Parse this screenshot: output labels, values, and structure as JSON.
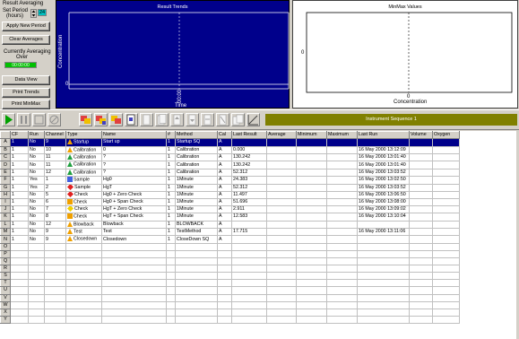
{
  "left_panel": {
    "heading": "Result Averaging",
    "set_period_label": "Set Period",
    "set_period_unit": "(hours)",
    "set_period_value": "24",
    "apply_button": "Apply New Period",
    "clear_button": "Clear Averages",
    "currently_label_1": "Currently Averaging",
    "currently_label_2": "Over",
    "currently_value": "00:00:00",
    "data_view_button": "Data View",
    "print_trends_button": "Print Trends",
    "print_minmax_button": "Print MinMax"
  },
  "trend_chart": {
    "title": "Result Trends",
    "ylabel": "Concentration",
    "xlabel": "Time",
    "y_tick": "0",
    "x_tick": "00:00"
  },
  "minmax_chart": {
    "title": "MinMax Values",
    "ylabel": "0",
    "xlabel": "Concentration",
    "x_tick": "0"
  },
  "toolbar": {
    "sequence_label": "Instrument Sequence 1"
  },
  "grid": {
    "columns": [
      "",
      "CF",
      "Run",
      "Channel",
      "Type",
      "Name",
      "#",
      "Method",
      "Cal",
      "Last Result",
      "Average",
      "Minimum",
      "Maximum",
      "Last Run",
      "Volume",
      "Oxygen"
    ],
    "rows": [
      {
        "h": "A",
        "cf": "1",
        "run": "No",
        "ch": "9",
        "icon": "tri-o",
        "type": "Startup",
        "name": "Start up",
        "num": "1",
        "method": "Startup SQ",
        "cal": "A",
        "last": "",
        "avg": "",
        "min": "",
        "max": "",
        "lastrun": "",
        "vol": "",
        "oxy": "",
        "selected": true
      },
      {
        "h": "B",
        "cf": "1",
        "run": "No",
        "ch": "10",
        "icon": "tri-o",
        "type": "Calibration",
        "name": "0",
        "num": "1",
        "method": "Calibration",
        "cal": "A",
        "last": "0.000",
        "avg": "",
        "min": "",
        "max": "",
        "lastrun": "16 May 2000   13:12:09",
        "vol": "",
        "oxy": ""
      },
      {
        "h": "C",
        "cf": "1",
        "run": "No",
        "ch": "11",
        "icon": "tri-g",
        "type": "Calibration",
        "name": "?",
        "num": "1",
        "method": "Calibration",
        "cal": "A",
        "last": "130.242",
        "avg": "",
        "min": "",
        "max": "",
        "lastrun": "16 May 2000   13:01:40",
        "vol": "",
        "oxy": ""
      },
      {
        "h": "D",
        "cf": "1",
        "run": "No",
        "ch": "11",
        "icon": "tri-g",
        "type": "Calibration",
        "name": "?",
        "num": "1",
        "method": "Calibration",
        "cal": "A",
        "last": "130.242",
        "avg": "",
        "min": "",
        "max": "",
        "lastrun": "16 May 2000   13:01:40",
        "vol": "",
        "oxy": ""
      },
      {
        "h": "E",
        "cf": "1",
        "run": "No",
        "ch": "12",
        "icon": "tri-g",
        "type": "Calibration",
        "name": "?",
        "num": "1",
        "method": "Calibration",
        "cal": "A",
        "last": "52.312",
        "avg": "",
        "min": "",
        "max": "",
        "lastrun": "16 May 2000   13:03:52",
        "vol": "",
        "oxy": ""
      },
      {
        "h": "F",
        "cf": "1",
        "run": "Yes",
        "ch": "1",
        "icon": "sq-b",
        "type": "Sample",
        "name": "Hg0",
        "num": "1",
        "method": "1Minute",
        "cal": "A",
        "last": "24.383",
        "avg": "",
        "min": "",
        "max": "",
        "lastrun": "16 May 2000   13:02:50",
        "vol": "",
        "oxy": ""
      },
      {
        "h": "G",
        "cf": "1",
        "run": "Yes",
        "ch": "2",
        "icon": "dia-r",
        "type": "Sample",
        "name": "HgT",
        "num": "1",
        "method": "1Minute",
        "cal": "A",
        "last": "52.312",
        "avg": "",
        "min": "",
        "max": "",
        "lastrun": "16 May 2000   13:03:52",
        "vol": "",
        "oxy": ""
      },
      {
        "h": "H",
        "cf": "1",
        "run": "No",
        "ch": "5",
        "icon": "dia-r",
        "type": "Check",
        "name": "Hg0 + Zero Check",
        "num": "1",
        "method": "1Minute",
        "cal": "A",
        "last": "11.497",
        "avg": "",
        "min": "",
        "max": "",
        "lastrun": "16 May 2000   13:06:50",
        "vol": "",
        "oxy": ""
      },
      {
        "h": "I",
        "cf": "1",
        "run": "No",
        "ch": "6",
        "icon": "sq-o",
        "type": "Check",
        "name": "Hg0 + Span Check",
        "num": "1",
        "method": "1Minute",
        "cal": "A",
        "last": "51.696",
        "avg": "",
        "min": "",
        "max": "",
        "lastrun": "16 May 2000   13:08:00",
        "vol": "",
        "oxy": ""
      },
      {
        "h": "J",
        "cf": "1",
        "run": "No",
        "ch": "7",
        "icon": "dia-y",
        "type": "Check",
        "name": "HgT + Zero Check",
        "num": "1",
        "method": "1Minute",
        "cal": "A",
        "last": "2.911",
        "avg": "",
        "min": "",
        "max": "",
        "lastrun": "16 May 2000   13:09:02",
        "vol": "",
        "oxy": ""
      },
      {
        "h": "K",
        "cf": "1",
        "run": "No",
        "ch": "8",
        "icon": "sq-o",
        "type": "Check",
        "name": "HgT + Span Check",
        "num": "1",
        "method": "1Minute",
        "cal": "A",
        "last": "12.583",
        "avg": "",
        "min": "",
        "max": "",
        "lastrun": "16 May 2000   13:10:04",
        "vol": "",
        "oxy": ""
      },
      {
        "h": "L",
        "cf": "1",
        "run": "No",
        "ch": "12",
        "icon": "tri-o",
        "type": "Blowback",
        "name": "Blowback",
        "num": "1",
        "method": "BLOWBACK",
        "cal": "A",
        "last": "",
        "avg": "",
        "min": "",
        "max": "",
        "lastrun": "",
        "vol": "",
        "oxy": ""
      },
      {
        "h": "M",
        "cf": "1",
        "run": "No",
        "ch": "9",
        "icon": "tri-o",
        "type": "Test",
        "name": "Test",
        "num": "1",
        "method": "TestMethod",
        "cal": "A",
        "last": "17.715",
        "avg": "",
        "min": "",
        "max": "",
        "lastrun": "16 May 2000   13:11:06",
        "vol": "",
        "oxy": ""
      },
      {
        "h": "N",
        "cf": "1",
        "run": "No",
        "ch": "9",
        "icon": "tri-o",
        "type": "Closedown",
        "name": "Closedown",
        "num": "1",
        "method": "CloseDown SQ",
        "cal": "A",
        "last": "",
        "avg": "",
        "min": "",
        "max": "",
        "lastrun": "",
        "vol": "",
        "oxy": ""
      },
      {
        "h": "O"
      },
      {
        "h": "P"
      },
      {
        "h": "Q"
      },
      {
        "h": "R"
      },
      {
        "h": "S"
      },
      {
        "h": "T"
      },
      {
        "h": "U"
      },
      {
        "h": "V"
      },
      {
        "h": "W"
      },
      {
        "h": "X"
      },
      {
        "h": "Y"
      }
    ]
  }
}
